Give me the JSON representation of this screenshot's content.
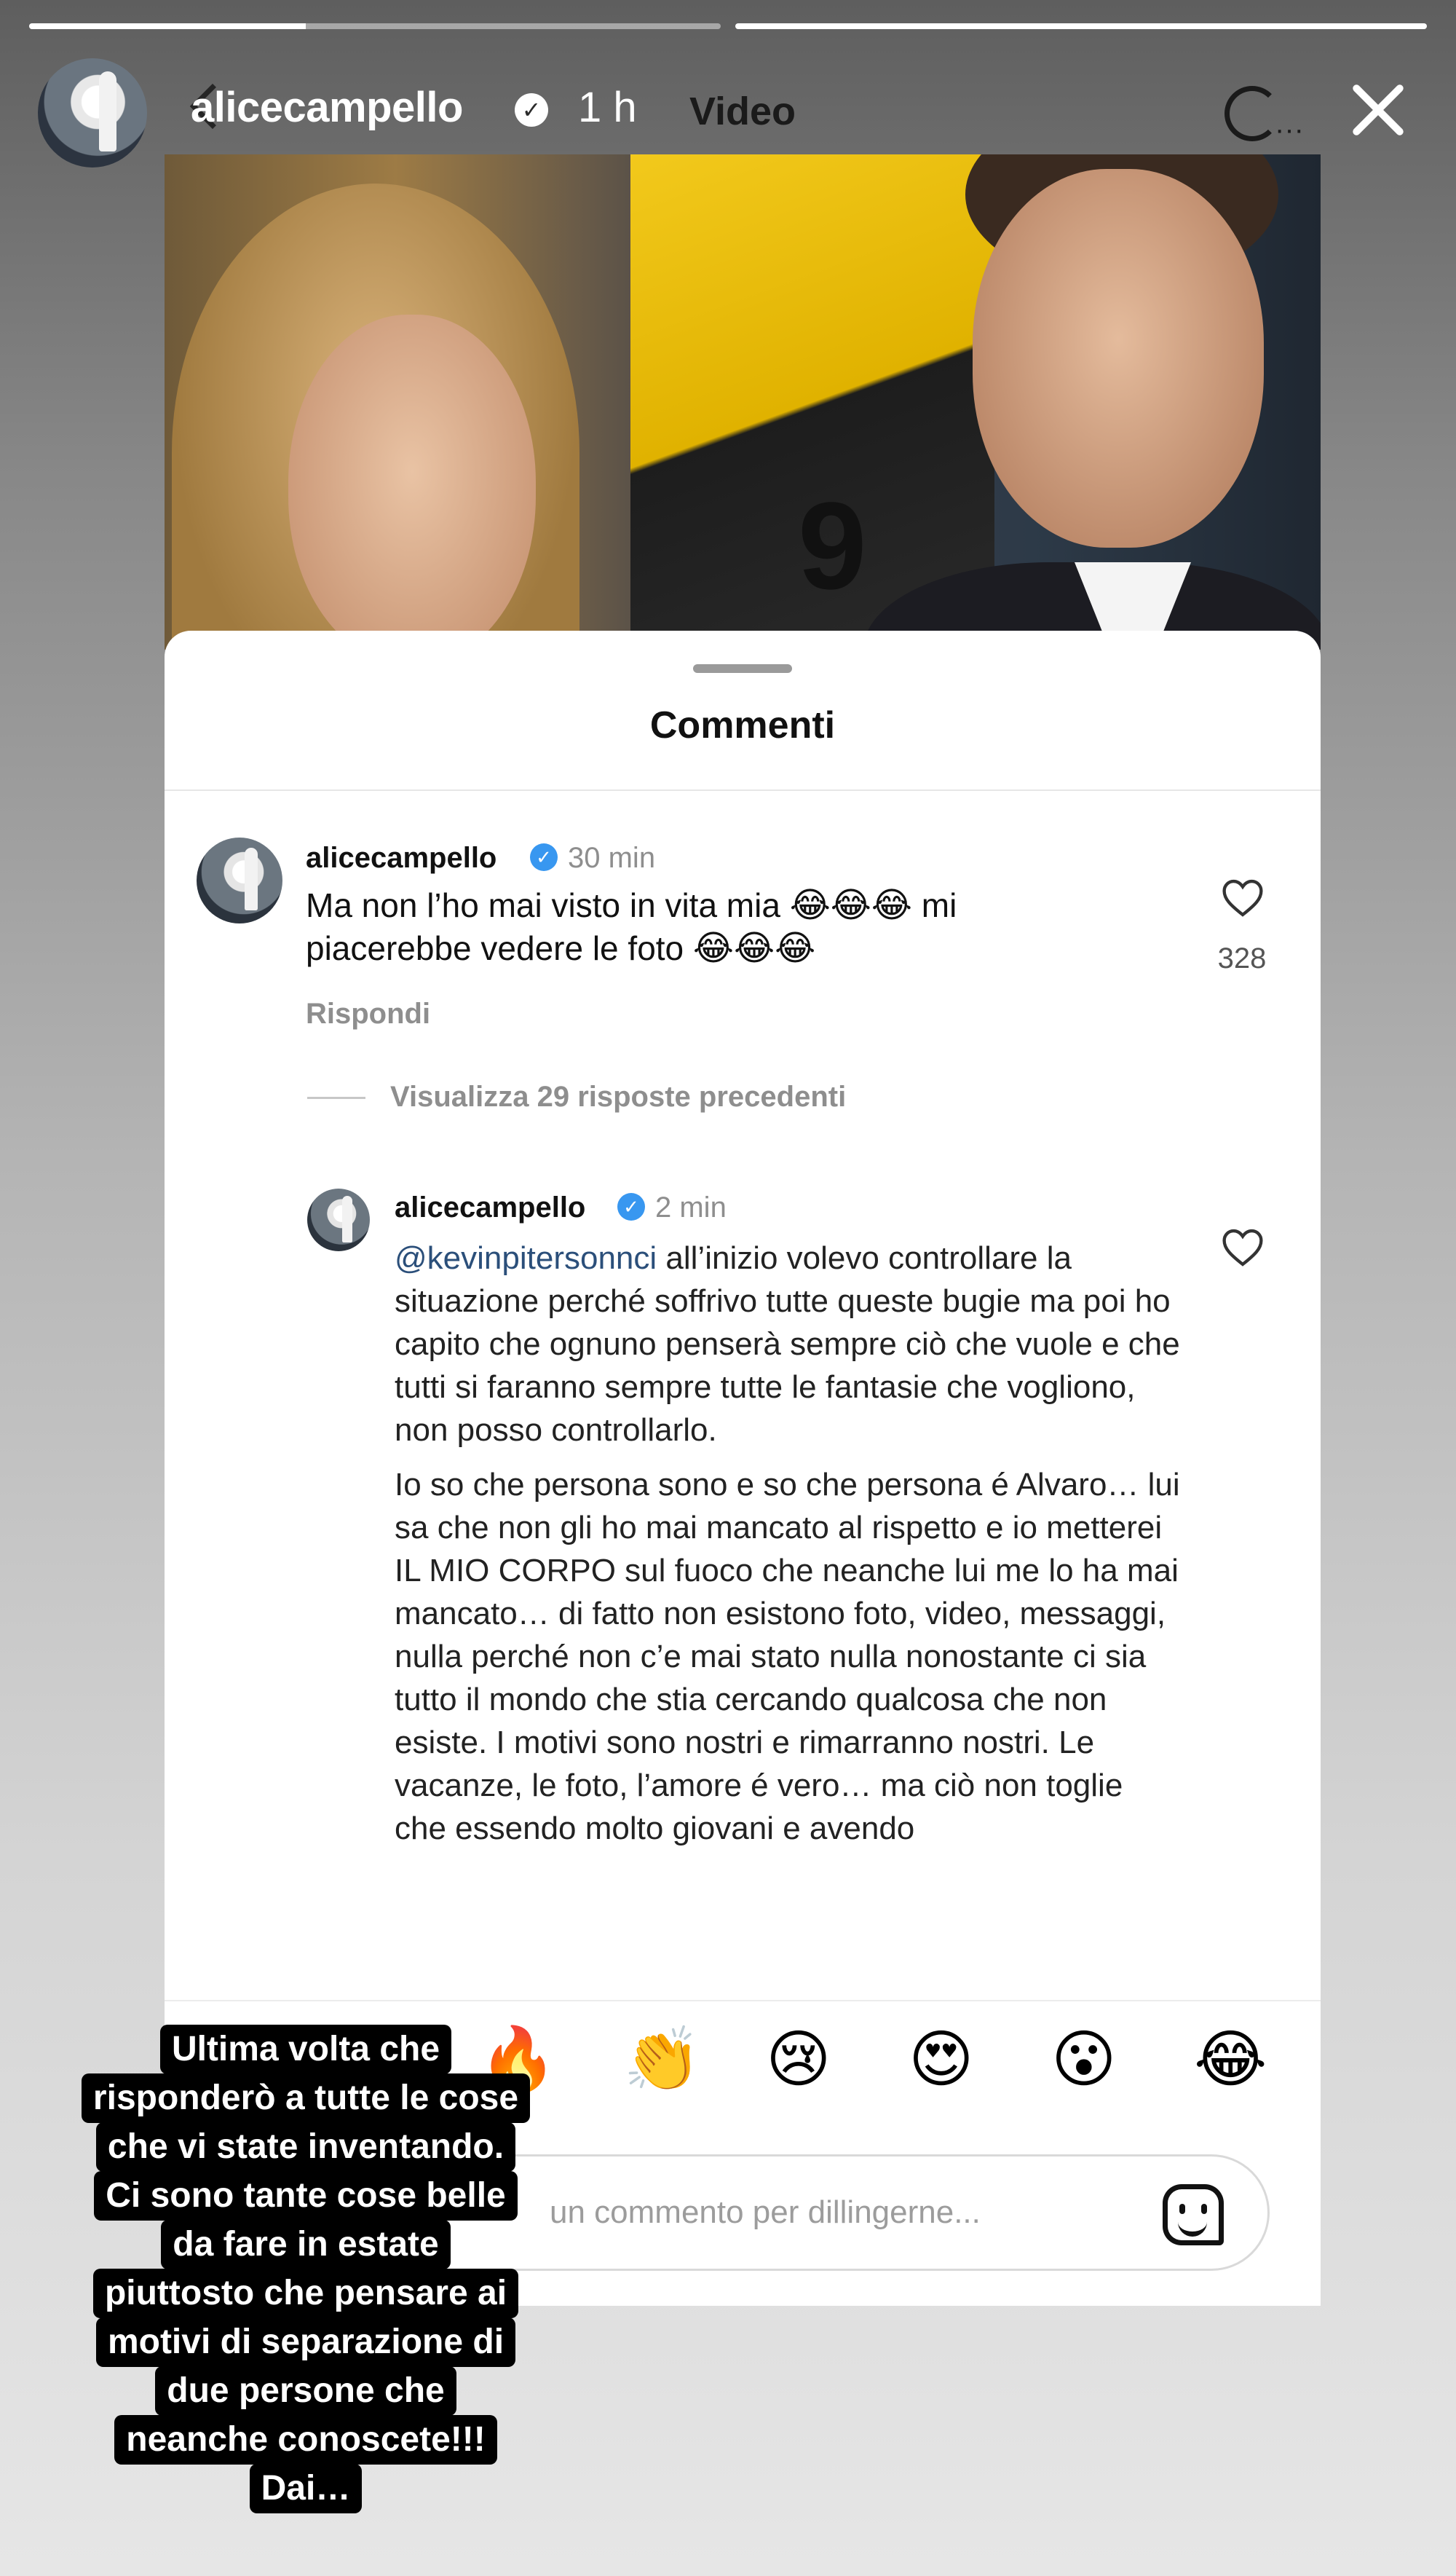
{
  "story": {
    "progress": [
      0.4,
      1.0
    ],
    "username": "alicecampello",
    "verified_icon": "verified-badge-icon",
    "time": "1 h"
  },
  "inner_screen": {
    "title": "Video",
    "panel_title": "Commenti",
    "comments": [
      {
        "username": "alicecampello",
        "time": "30 min",
        "text_lines": [
          [
            "Ma non l’ho mai visto in vita mia ",
            "😂😂😂",
            " mi"
          ],
          [
            "piacerebbe vedere le foto ",
            "😂😂😂",
            ""
          ]
        ],
        "likes": "328",
        "reply_label": "Rispondi"
      }
    ],
    "view_replies": "Visualizza 29 risposte precedenti",
    "reply": {
      "username": "alicecampello",
      "time": "2 min",
      "mention": "@kevinpitersonnci",
      "paragraph1_rest": " all’inizio volevo controllare la situazione perché soffrivo tutte queste bugie ma poi ho capito che ognuno penserà sempre ciò che vuole e che tutti si faranno sempre tutte le fantasie che vogliono, non posso controllarlo.",
      "paragraph2": "Io so che persona sono e so che persona é Alvaro… lui sa che non gli ho mai mancato al rispetto e io metterei IL MIO CORPO sul fuoco che neanche lui me lo ha mai mancato… di fatto non esistono foto, video, messaggi, nulla perché non c’e mai stato nulla nonostante ci sia tutto il mondo che stia cercando qualcosa che non esiste. I motivi sono nostri e rimarranno nostri. Le vacanze, le foto, l’amore é vero… ma ciò non toglie che essendo molto giovani e avendo"
    },
    "emoji_reactions": [
      "🔥",
      "👏",
      "😢",
      "😍",
      "😮",
      "😂"
    ],
    "comment_placeholder": "un commento per dillingerne..."
  },
  "caption": {
    "lines": [
      "Ultima volta che",
      "risponderò a tutte le cose",
      "che vi state inventando.",
      "Ci sono tante cose belle",
      "da fare in estate",
      "piuttosto che pensare ai",
      "motivi di separazione di",
      "due persone che",
      "neanche conoscete!!!",
      "Dai…"
    ]
  },
  "colors": {
    "verified_blue": "#3897f0",
    "mention_blue": "#2b4f7a",
    "caption_bg": "#000000"
  }
}
